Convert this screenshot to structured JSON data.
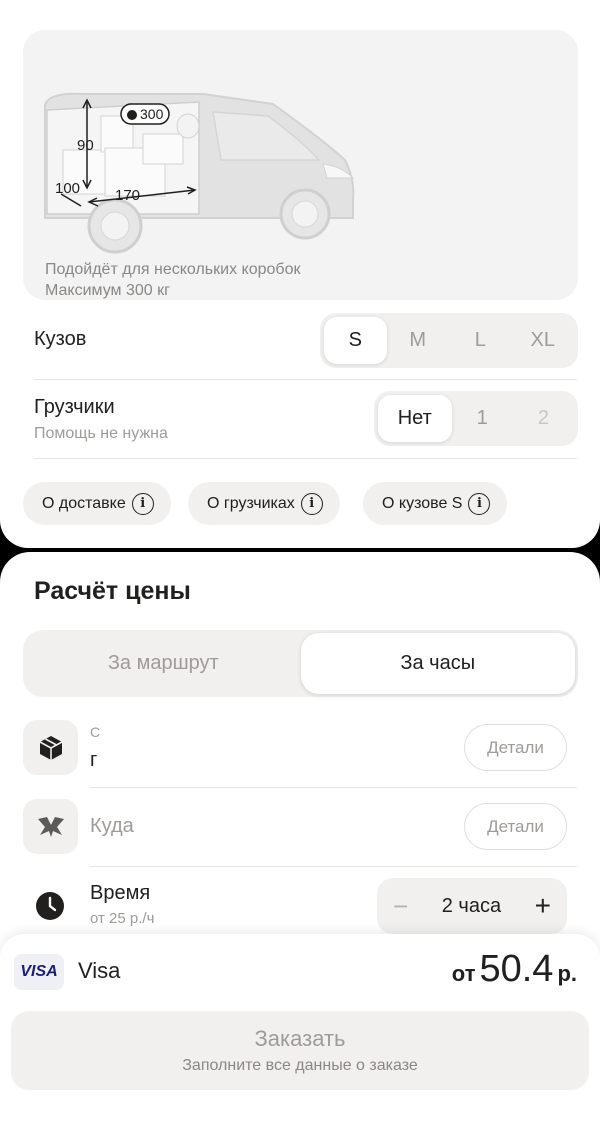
{
  "vehicle": {
    "weight_badge": "300",
    "dim_height": "90",
    "dim_width": "100",
    "dim_length": "170",
    "description_line1": "Подойдёт для нескольких коробок",
    "description_line2": "Максимум 300 кг"
  },
  "body_size": {
    "label": "Кузов",
    "options": [
      "S",
      "M",
      "L",
      "XL"
    ],
    "selected": "S"
  },
  "movers": {
    "label": "Грузчики",
    "subtitle": "Помощь не нужна",
    "options": [
      "Нет",
      "1",
      "2"
    ],
    "selected": "Нет"
  },
  "info_chips": [
    "О доставке",
    "О грузчиках",
    "О кузове S"
  ],
  "pricing": {
    "title": "Расчёт цены",
    "tabs": [
      "За маршрут",
      "За часы"
    ],
    "active_tab": "За часы"
  },
  "route": {
    "from_text_l1": "С",
    "from_text_l2": "г",
    "to_placeholder": "Куда",
    "details_label": "Детали"
  },
  "time": {
    "label": "Время",
    "rate": "от 25 р./ч",
    "value": "2 часа",
    "minus": "−",
    "plus": "+"
  },
  "payment": {
    "card_brand": "VISA",
    "card_label": "Visa",
    "price_prefix": "от",
    "price_value": "50.4",
    "price_currency": "р."
  },
  "order": {
    "button_label": "Заказать",
    "button_hint": "Заполните все данные о заказе"
  }
}
